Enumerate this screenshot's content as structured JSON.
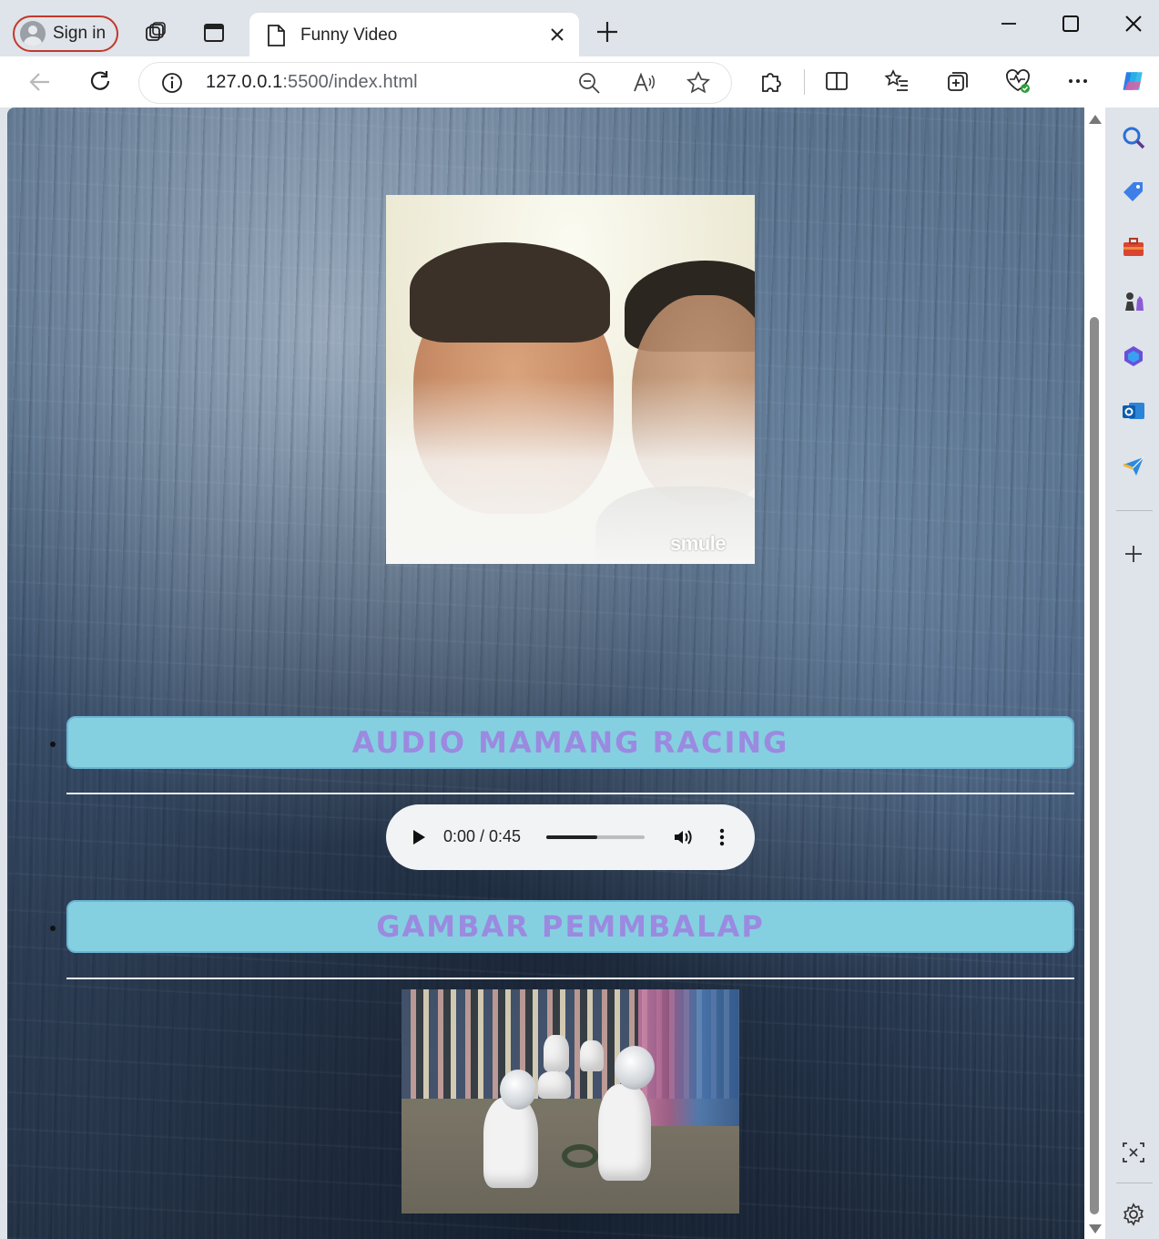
{
  "browser": {
    "sign_in_label": "Sign in",
    "tab_title": "Funny Video",
    "url_host": "127.0.0.1",
    "url_path": ":5500/index.html"
  },
  "page": {
    "section1_title": "AUDIO MAMANG RACING",
    "audio_time": "0:00 / 0:45",
    "audio_progress": 0.52,
    "section2_title": "GAMBAR PEMMBALAP",
    "video_watermark": "smule"
  },
  "colors": {
    "list_item_bg": "#84d0e0",
    "list_item_text": "#9b8ae0",
    "signin_border": "#c0392b"
  }
}
